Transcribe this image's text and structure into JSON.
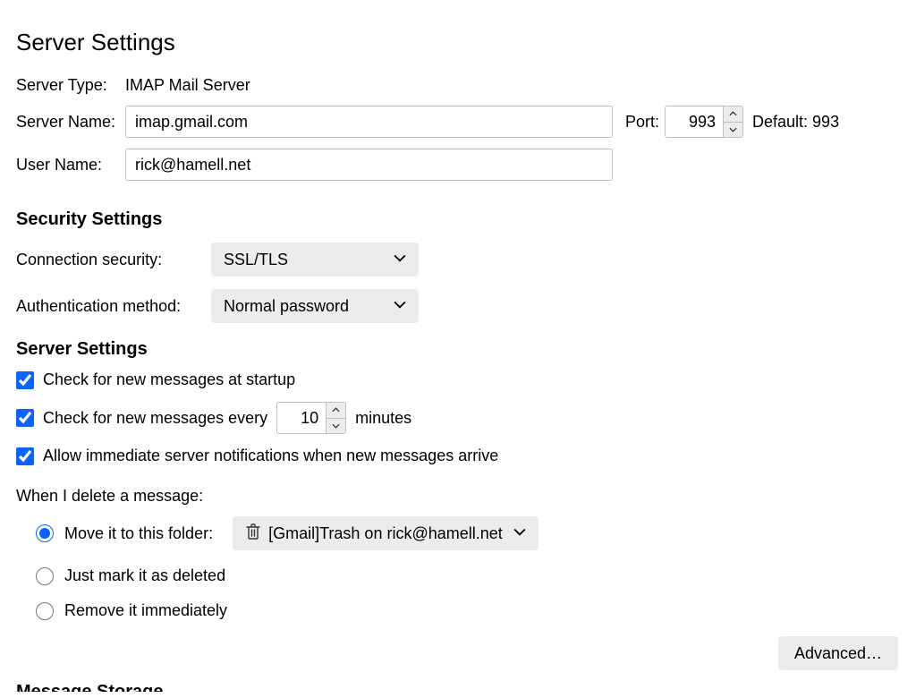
{
  "page_title": "Server Settings",
  "server_type_label": "Server Type:",
  "server_type_value": "IMAP Mail Server",
  "server_name_label": "Server Name:",
  "server_name_value": "imap.gmail.com",
  "port_label": "Port:",
  "port_value": "993",
  "default_port_text": "Default: 993",
  "user_name_label": "User Name:",
  "user_name_value": "rick@hamell.net",
  "security": {
    "heading": "Security Settings",
    "connection_label": "Connection security:",
    "connection_value": "SSL/TLS",
    "auth_label": "Authentication method:",
    "auth_value": "Normal password"
  },
  "server": {
    "heading": "Server Settings",
    "check_startup": "Check for new messages at startup",
    "check_every_pre": "Check for new messages every",
    "check_every_minutes": "10",
    "check_every_post": "minutes",
    "allow_immediate": "Allow immediate server notifications when new messages arrive"
  },
  "delete": {
    "heading": "When I delete a message:",
    "opt_move": "Move it to this folder:",
    "folder_value": "[Gmail]Trash on rick@hamell.net",
    "opt_mark": "Just mark it as deleted",
    "opt_remove": "Remove it immediately"
  },
  "advanced_button": "Advanced…",
  "next_section_partial": "Message Storage"
}
